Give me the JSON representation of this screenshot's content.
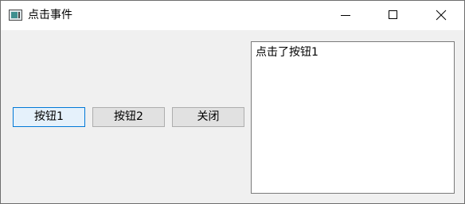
{
  "window": {
    "title": "点击事件",
    "app_icon": "window-icon",
    "controls": {
      "minimize_icon": "minimize-icon",
      "maximize_icon": "maximize-icon",
      "close_icon": "close-icon"
    }
  },
  "buttons": [
    {
      "label": "按钮1",
      "focused": true
    },
    {
      "label": "按钮2",
      "focused": false
    },
    {
      "label": "关闭",
      "focused": false
    }
  ],
  "output": {
    "text": "点击了按钮1"
  },
  "colors": {
    "focus_border": "#0078d7",
    "focus_fill": "#e5f1fb",
    "button_fill": "#e1e1e1",
    "client_background": "#f0f0f0"
  }
}
